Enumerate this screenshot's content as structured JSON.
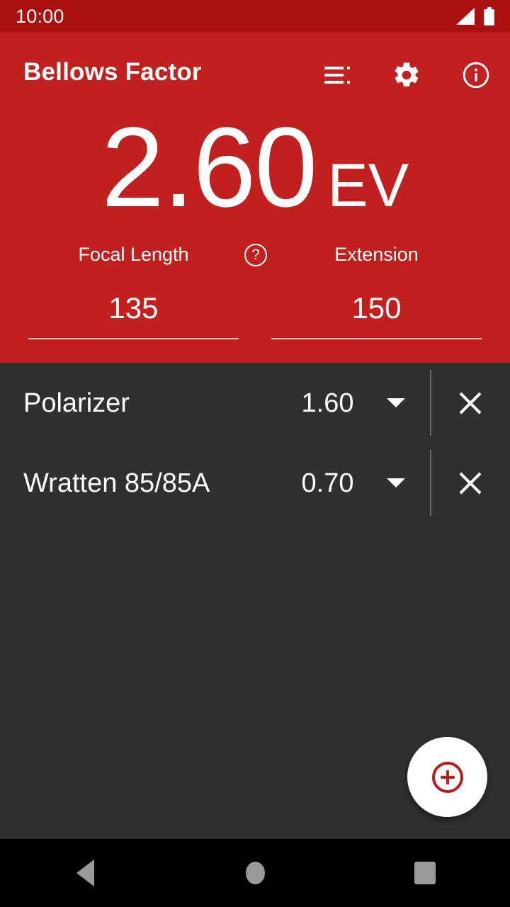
{
  "status_bar": {
    "time": "10:00",
    "signal_icon": "signal-cellular-icon",
    "battery_icon": "battery-icon"
  },
  "app_bar": {
    "title": "Bellows Factor",
    "actions": [
      {
        "name": "list-icon",
        "label": "List"
      },
      {
        "name": "gear-icon",
        "label": "Settings"
      },
      {
        "name": "info-icon",
        "label": "Info"
      }
    ]
  },
  "result": {
    "value": "2.60",
    "unit": "EV"
  },
  "inputs": {
    "help_icon": "help-circle-icon",
    "help_glyph": "?",
    "focal_length": {
      "label": "Focal Length",
      "value": "135"
    },
    "extension": {
      "label": "Extension",
      "value": "150"
    }
  },
  "filters": [
    {
      "name": "Polarizer",
      "value": "1.60",
      "caret_icon": "chevron-down-icon",
      "remove_icon": "close-icon"
    },
    {
      "name": "Wratten 85/85A",
      "value": "0.70",
      "caret_icon": "chevron-down-icon",
      "remove_icon": "close-icon"
    }
  ],
  "fab": {
    "icon": "add-circle-icon",
    "label": "Add filter"
  },
  "nav_bar": {
    "back": "back-icon",
    "home": "home-icon",
    "recents": "recents-icon"
  },
  "colors": {
    "status_bar_red": "#a9100f",
    "header_red": "#c1201e",
    "surface_dark": "#303030",
    "nav_black": "#000000",
    "accent_white": "#ffffff",
    "fab_icon_red": "#b3201c"
  }
}
